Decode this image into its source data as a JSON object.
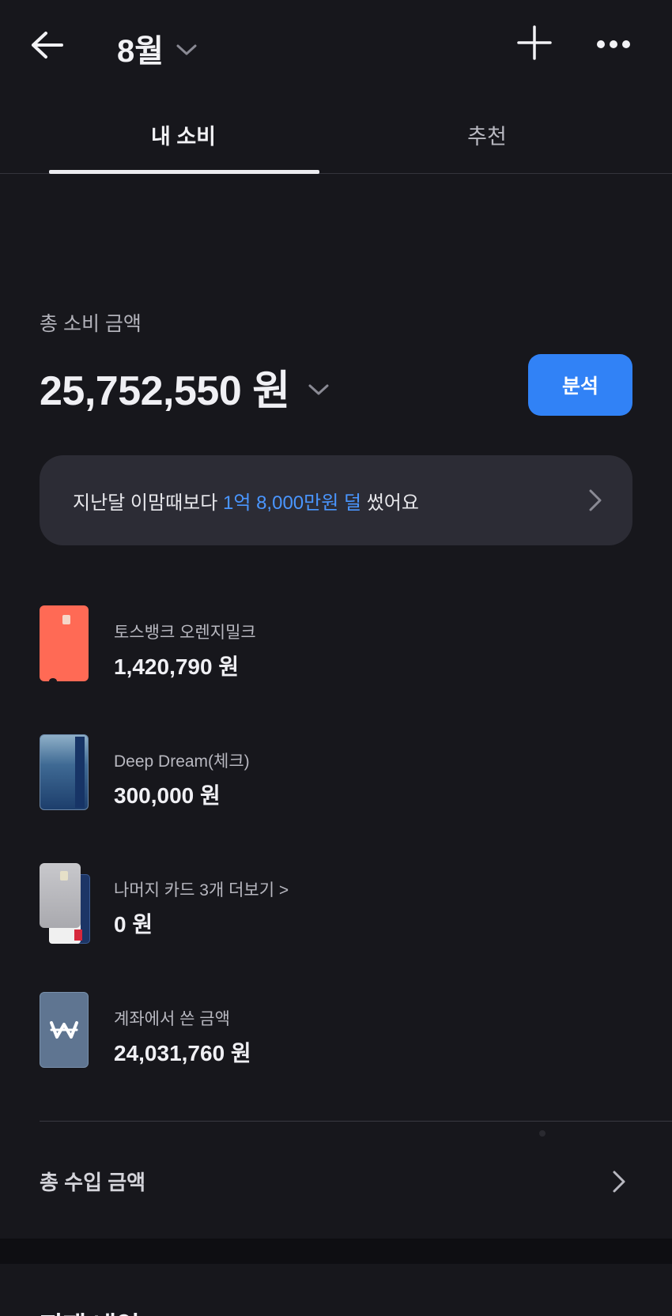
{
  "header": {
    "month": "8월",
    "icons": {
      "back": "arrow-left-icon",
      "month_dropdown": "chevron-down-icon",
      "add": "plus-icon",
      "more": "more-horizontal-icon"
    }
  },
  "tabs": [
    {
      "label": "내 소비",
      "active": true
    },
    {
      "label": "추천",
      "active": false
    }
  ],
  "summary": {
    "total_label": "총 소비 금액",
    "total_amount": "25,752,550 원",
    "analyze_label": "분석",
    "accent_color": "#3182f6"
  },
  "compare": {
    "prefix": "지난달 이맘때보다 ",
    "highlight": "1억 8,000만원 덜",
    "suffix": " 썼어요",
    "highlight_color": "#4a96ff"
  },
  "cards": [
    {
      "name": "토스뱅크 오렌지밀크",
      "amount": "1,420,790 원"
    },
    {
      "name": "Deep Dream(체크)",
      "amount": "300,000 원"
    },
    {
      "name": "나머지 카드 3개 더보기 >",
      "amount": "0 원"
    },
    {
      "name": "계좌에서 쓴 금액",
      "amount": "24,031,760 원",
      "icon": "won-icon"
    }
  ],
  "income": {
    "label": "총 수입 금액"
  },
  "bottom": {
    "title": "지재 내역"
  }
}
